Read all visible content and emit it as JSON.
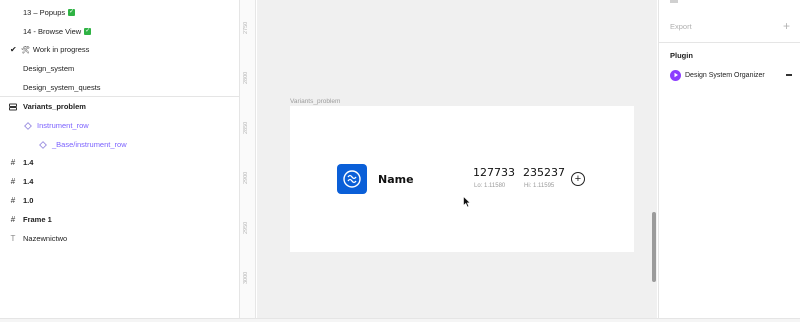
{
  "layers": [
    {
      "label": "13 – Popups",
      "check": true
    },
    {
      "label": "14 - Browse View",
      "check": true
    },
    {
      "label": "Work in progress",
      "prefix": "✔",
      "emoji": "🛠"
    },
    {
      "label": "Design_system"
    },
    {
      "label": "Design_system_quests"
    },
    {
      "label": "Variants_problem",
      "icon": "component-set-icon"
    },
    {
      "label": "Instrument_row",
      "icon": "component-variant-icon"
    },
    {
      "label": "_Base/instrument_row",
      "icon": "component-variant-icon"
    },
    {
      "label": "1.4",
      "icon": "frame-hash-icon"
    },
    {
      "label": "1.4",
      "icon": "frame-hash-icon"
    },
    {
      "label": "1.0",
      "icon": "frame-hash-icon"
    },
    {
      "label": "Frame 1",
      "icon": "frame-hash-icon"
    },
    {
      "label": "Nazewnictwo",
      "icon": "text-icon"
    }
  ],
  "ruler": [
    "2750",
    "2800",
    "2850",
    "2900",
    "2950",
    "3000",
    "3050",
    "3100",
    "3150"
  ],
  "canvas": {
    "frame_label": "Variants_problem",
    "name": "Name",
    "value1": "127733",
    "sub1": "Lo: 1.11580",
    "value2": "235237",
    "sub2": "Hi: 1.11595",
    "add_symbol": "+"
  },
  "right_panel": {
    "export_title": "Export",
    "add_symbol": "+",
    "plugin_title": "Plugin",
    "plugin_name": "Design System Organizer"
  },
  "colors": {
    "accent": "#7b61ff",
    "logo_bg": "#0a5fd8",
    "plugin_icon": "#8c3dff",
    "check": "#2fb344"
  }
}
